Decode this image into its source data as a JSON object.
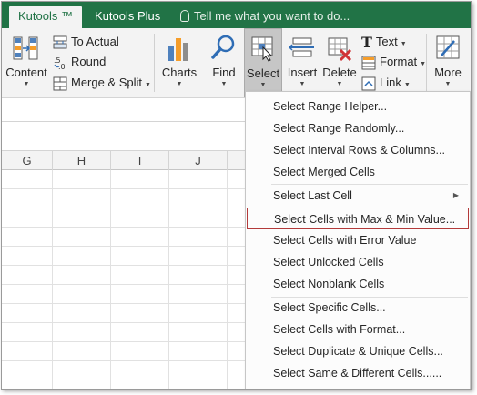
{
  "tabs": [
    {
      "label": "Kutools ™",
      "active": true
    },
    {
      "label": "Kutools Plus",
      "active": false
    }
  ],
  "tell_me": "Tell me what you want to do...",
  "ribbon": {
    "content": {
      "label": "Content"
    },
    "to_actual": {
      "label": "To Actual"
    },
    "round": {
      "label": "Round"
    },
    "merge_split": {
      "label": "Merge & Split"
    },
    "charts": {
      "label": "Charts"
    },
    "find": {
      "label": "Find"
    },
    "select": {
      "label": "Select",
      "pressed": true
    },
    "insert": {
      "label": "Insert"
    },
    "delete": {
      "label": "Delete"
    },
    "text": {
      "label": "Text"
    },
    "format": {
      "label": "Format"
    },
    "link": {
      "label": "Link"
    },
    "more": {
      "label": "More"
    }
  },
  "columns": [
    "G",
    "H",
    "I",
    "J"
  ],
  "menu": {
    "items": [
      {
        "label": "Select Range Helper..."
      },
      {
        "label": "Select Range Randomly..."
      },
      {
        "label": "Select Interval Rows & Columns..."
      },
      {
        "label": "Select Merged Cells"
      },
      {
        "label": "Select Last Cell",
        "submenu": true
      },
      {
        "label": "Select Cells with Max & Min Value...",
        "highlighted": true
      },
      {
        "label": "Select Cells with Error Value"
      },
      {
        "label": "Select Unlocked Cells"
      },
      {
        "label": "Select Nonblank Cells"
      },
      {
        "label": "Select Specific Cells..."
      },
      {
        "label": "Select Cells with Format..."
      },
      {
        "label": "Select Duplicate & Unique Cells..."
      },
      {
        "label": "Select Same & Different Cells......"
      }
    ]
  },
  "colors": {
    "accent": "#217346",
    "highlight_border": "#b33a3a"
  }
}
